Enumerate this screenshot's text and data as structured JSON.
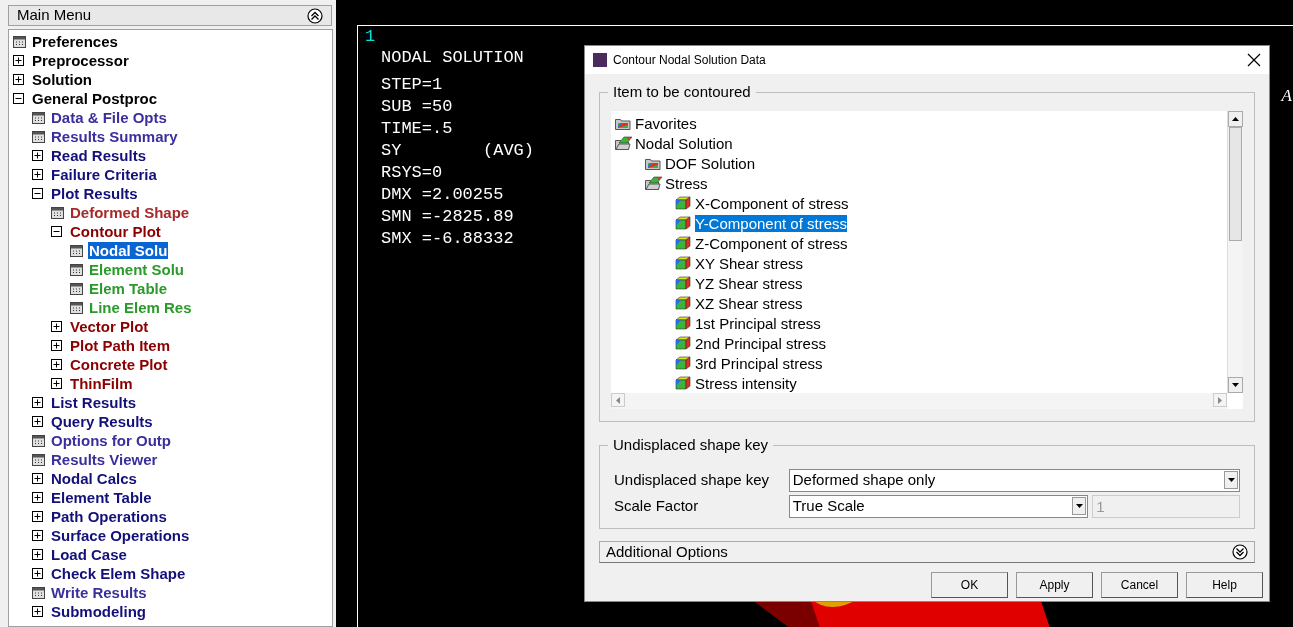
{
  "main_menu": {
    "title": "Main Menu",
    "items": [
      {
        "label": "Preferences",
        "kind": "dialog",
        "color": "#000000",
        "selected": false
      },
      {
        "label": "Preprocessor",
        "kind": "folder",
        "expanded": false,
        "color": "#000000",
        "selected": false
      },
      {
        "label": "Solution",
        "kind": "folder",
        "expanded": false,
        "color": "#000000",
        "selected": false
      },
      {
        "label": "General Postproc",
        "kind": "folder",
        "expanded": true,
        "color": "#000000",
        "selected": false,
        "children": [
          {
            "label": "Data & File Opts",
            "kind": "dialog",
            "color": "#3a2f9c",
            "selected": false
          },
          {
            "label": "Results Summary",
            "kind": "dialog",
            "color": "#3a2f9c",
            "selected": false
          },
          {
            "label": "Read Results",
            "kind": "folder",
            "expanded": false,
            "color": "#14107a",
            "selected": false
          },
          {
            "label": "Failure Criteria",
            "kind": "folder",
            "expanded": false,
            "color": "#14107a",
            "selected": false
          },
          {
            "label": "Plot Results",
            "kind": "folder",
            "expanded": true,
            "color": "#14107a",
            "selected": false,
            "children": [
              {
                "label": "Deformed Shape",
                "kind": "dialog",
                "color": "#a52a2a",
                "selected": false
              },
              {
                "label": "Contour Plot",
                "kind": "folder",
                "expanded": true,
                "color": "#8b0000",
                "selected": false,
                "children": [
                  {
                    "label": "Nodal Solu",
                    "kind": "dialog",
                    "selected": true
                  },
                  {
                    "label": "Element Solu",
                    "kind": "dialog",
                    "color": "#2a9a2a",
                    "selected": false
                  },
                  {
                    "label": "Elem Table",
                    "kind": "dialog",
                    "color": "#2a9a2a",
                    "selected": false
                  },
                  {
                    "label": "Line Elem Res",
                    "kind": "dialog",
                    "color": "#2a9a2a",
                    "selected": false
                  }
                ]
              },
              {
                "label": "Vector Plot",
                "kind": "folder",
                "expanded": false,
                "color": "#8b0000",
                "selected": false
              },
              {
                "label": "Plot Path Item",
                "kind": "folder",
                "expanded": false,
                "color": "#8b0000",
                "selected": false
              },
              {
                "label": "Concrete Plot",
                "kind": "folder",
                "expanded": false,
                "color": "#8b0000",
                "selected": false
              },
              {
                "label": "ThinFilm",
                "kind": "folder",
                "expanded": false,
                "color": "#8b0000",
                "selected": false
              }
            ]
          },
          {
            "label": "List Results",
            "kind": "folder",
            "expanded": false,
            "color": "#14107a",
            "selected": false
          },
          {
            "label": "Query Results",
            "kind": "folder",
            "expanded": false,
            "color": "#14107a",
            "selected": false
          },
          {
            "label": "Options for Outp",
            "kind": "dialog",
            "color": "#3a2f9c",
            "selected": false
          },
          {
            "label": "Results Viewer",
            "kind": "dialog",
            "color": "#3a2f9c",
            "selected": false
          },
          {
            "label": "Nodal Calcs",
            "kind": "folder",
            "expanded": false,
            "color": "#14107a",
            "selected": false
          },
          {
            "label": "Element Table",
            "kind": "folder",
            "expanded": false,
            "color": "#14107a",
            "selected": false
          },
          {
            "label": "Path Operations",
            "kind": "folder",
            "expanded": false,
            "color": "#14107a",
            "selected": false
          },
          {
            "label": "Surface Operations",
            "kind": "folder",
            "expanded": false,
            "color": "#14107a",
            "selected": false
          },
          {
            "label": "Load Case",
            "kind": "folder",
            "expanded": false,
            "color": "#14107a",
            "selected": false
          },
          {
            "label": "Check Elem Shape",
            "kind": "folder",
            "expanded": false,
            "color": "#14107a",
            "selected": false
          },
          {
            "label": "Write Results",
            "kind": "dialog",
            "color": "#3a2f9c",
            "selected": false
          },
          {
            "label": "Submodeling",
            "kind": "folder",
            "expanded": false,
            "color": "#14107a",
            "selected": false
          }
        ]
      }
    ]
  },
  "graphics": {
    "window_number": "1",
    "title": "NODAL SOLUTION",
    "lines": [
      "STEP=1",
      "SUB =50",
      "TIME=.5",
      "SY        (AVG)",
      "RSYS=0",
      "DMX =2.00255",
      "SMN =-2825.89",
      "SMX =-6.88332"
    ],
    "edge_label": "A"
  },
  "dialog": {
    "title": "Contour Nodal Solution Data",
    "item_group": {
      "title": "Item to be contoured",
      "items": [
        {
          "label": "Favorites",
          "kind": "folder",
          "selected": false
        },
        {
          "label": "Nodal Solution",
          "kind": "open-folder",
          "selected": false,
          "children": [
            {
              "label": "DOF Solution",
              "kind": "folder",
              "selected": false
            },
            {
              "label": "Stress",
              "kind": "open-folder",
              "selected": false,
              "children": [
                {
                  "label": "X-Component of stress",
                  "kind": "item",
                  "selected": false
                },
                {
                  "label": "Y-Component of stress",
                  "kind": "item",
                  "selected": true
                },
                {
                  "label": "Z-Component of stress",
                  "kind": "item",
                  "selected": false
                },
                {
                  "label": "XY Shear stress",
                  "kind": "item",
                  "selected": false
                },
                {
                  "label": "YZ Shear stress",
                  "kind": "item",
                  "selected": false
                },
                {
                  "label": "XZ Shear stress",
                  "kind": "item",
                  "selected": false
                },
                {
                  "label": "1st Principal stress",
                  "kind": "item",
                  "selected": false
                },
                {
                  "label": "2nd Principal stress",
                  "kind": "item",
                  "selected": false
                },
                {
                  "label": "3rd Principal stress",
                  "kind": "item",
                  "selected": false
                },
                {
                  "label": "Stress intensity",
                  "kind": "item",
                  "selected": false
                }
              ]
            }
          ]
        }
      ]
    },
    "shape_group": {
      "title": "Undisplaced shape key",
      "fields": [
        {
          "label": "Undisplaced shape key",
          "value": "Deformed shape only"
        },
        {
          "label": "Scale Factor",
          "value": "True Scale",
          "extra_value": "1",
          "extra_disabled": true
        }
      ]
    },
    "additional_options": {
      "label": "Additional Options",
      "expanded": false
    },
    "buttons": [
      "OK",
      "Apply",
      "Cancel",
      "Help"
    ]
  }
}
